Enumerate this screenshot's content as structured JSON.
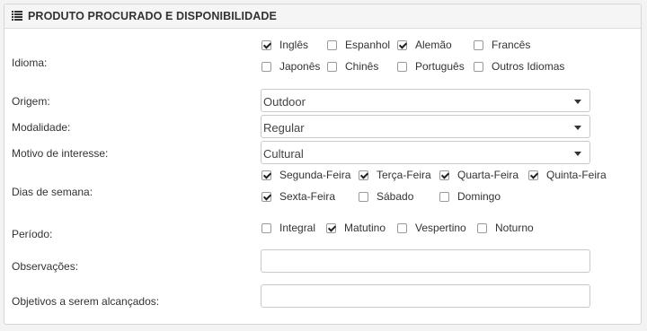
{
  "header": {
    "title": "PRODUTO PROCURADO E DISPONIBILIDADE",
    "icon": "list-icon"
  },
  "idioma": {
    "label": "Idioma:",
    "options": [
      {
        "label": "Inglês",
        "checked": true
      },
      {
        "label": "Espanhol",
        "checked": false
      },
      {
        "label": "Alemão",
        "checked": true
      },
      {
        "label": "Francês",
        "checked": false
      },
      {
        "label": "Japonês",
        "checked": false
      },
      {
        "label": "Chinês",
        "checked": false
      },
      {
        "label": "Português",
        "checked": false
      },
      {
        "label": "Outros Idiomas",
        "checked": false
      }
    ]
  },
  "origem": {
    "label": "Origem:",
    "value": "Outdoor"
  },
  "modalidade": {
    "label": "Modalidade:",
    "value": "Regular"
  },
  "motivo": {
    "label": "Motivo de interesse:",
    "value": "Cultural"
  },
  "dias": {
    "label": "Dias de semana:",
    "options": [
      {
        "label": "Segunda-Feira",
        "checked": true
      },
      {
        "label": "Terça-Feira",
        "checked": true
      },
      {
        "label": "Quarta-Feira",
        "checked": true
      },
      {
        "label": "Quinta-Feira",
        "checked": true
      },
      {
        "label": "Sexta-Feira",
        "checked": true
      },
      {
        "label": "Sábado",
        "checked": false
      },
      {
        "label": "Domingo",
        "checked": false
      }
    ]
  },
  "periodo": {
    "label": "Período:",
    "options": [
      {
        "label": "Integral",
        "checked": false
      },
      {
        "label": "Matutino",
        "checked": true
      },
      {
        "label": "Vespertino",
        "checked": false
      },
      {
        "label": "Noturno",
        "checked": false
      }
    ]
  },
  "observacoes": {
    "label": "Observações:",
    "value": ""
  },
  "objetivos": {
    "label": "Objetivos a serem alcançados:",
    "value": ""
  }
}
